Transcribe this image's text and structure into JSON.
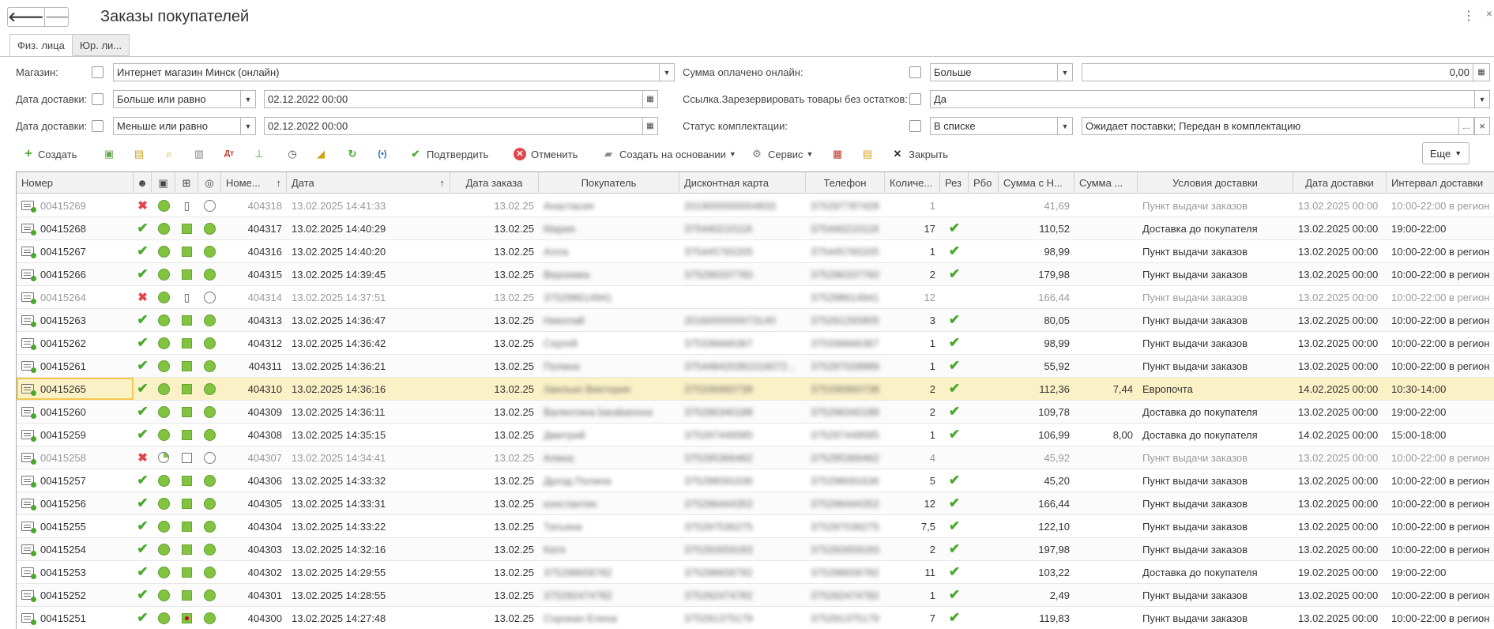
{
  "window": {
    "title": "Заказы покупателей",
    "nav_back": "🡐",
    "nav_forward": "🡒",
    "more": "⋮",
    "close": "×"
  },
  "tabs": [
    {
      "label": "Физ. лица",
      "active": true
    },
    {
      "label": "Юр. ли...",
      "active": false
    }
  ],
  "filters": {
    "magazin_label": "Магазин:",
    "magazin_value": "Интернет магазин Минск (онлайн)",
    "data_dost1_label": "Дата доставки:",
    "data_dost1_op": "Больше или равно",
    "data_dost1_value": "02.12.2022 00:00",
    "data_dost2_label": "Дата доставки:",
    "data_dost2_op": "Меньше или равно",
    "data_dost2_value": "02.12.2022 00:00",
    "summa_label": "Сумма оплачено онлайн:",
    "summa_op": "Больше",
    "summa_value": "0,00",
    "ssylka_label": "Ссылка.Зарезервировать товары без остатков:",
    "ssylka_value": "Да",
    "status_label": "Статус комплектации:",
    "status_op": "В списке",
    "status_value": "Ожидает поставки; Передан в комплектацию",
    "dots": "...",
    "clear": "×"
  },
  "toolbar": {
    "create": "Создать",
    "confirm": "Подтвердить",
    "cancel": "Отменить",
    "create_based": "Создать на основании",
    "service": "Сервис",
    "close": "Закрыть",
    "more": "Еще"
  },
  "colors": {
    "green": "#82c341",
    "check": "#4aa82c",
    "cross": "#e2454b",
    "selected_row": "#fbf1c7"
  },
  "columns": [
    "Номер",
    "Номе...",
    "Дата",
    "Дата заказа",
    "Покупатель",
    "Дисконтная карта",
    "Телефон",
    "Количе...",
    "Рез",
    "Рбо",
    "Сумма с Н...",
    "Сумма ...",
    "Условия доставки",
    "Дата доставки",
    "Интервал доставки"
  ],
  "sort_arrows": {
    "nome": "↑",
    "data": "↑"
  },
  "rows": [
    {
      "num": "00415269",
      "s1": "x",
      "s2": "dot",
      "s3": "book",
      "s4": "empty",
      "n2": "404318",
      "date": "13.02.2025 14:41:33",
      "dz": "13.02.25",
      "buyer": "Анастасия",
      "card": "2019000000004833",
      "phone": "375297787428",
      "qty": "1",
      "rez": "",
      "sum": "41,69",
      "sum2": "",
      "cond": "Пункт выдачи заказов",
      "dd": "13.02.2025 00:00",
      "int": "10:00-22:00 в регион",
      "grey": true
    },
    {
      "num": "00415268",
      "s1": "v",
      "s2": "dot",
      "s3": "sq",
      "s4": "dot",
      "n2": "404317",
      "date": "13.02.2025 14:40:29",
      "dz": "13.02.25",
      "buyer": "Мария",
      "card": "375440210118",
      "phone": "375440210118",
      "qty": "17",
      "rez": "v",
      "sum": "110,52",
      "sum2": "",
      "cond": "Доставка до покупателя",
      "dd": "13.02.2025 00:00",
      "int": "19:00-22:00"
    },
    {
      "num": "00415267",
      "s1": "v",
      "s2": "dot",
      "s3": "sq",
      "s4": "dot",
      "n2": "404316",
      "date": "13.02.2025 14:40:20",
      "dz": "13.02.25",
      "buyer": "Алла",
      "card": "375445765205",
      "phone": "375445765205",
      "qty": "1",
      "rez": "v",
      "sum": "98,99",
      "sum2": "",
      "cond": "Пункт выдачи заказов",
      "dd": "13.02.2025 00:00",
      "int": "10:00-22:00 в регион"
    },
    {
      "num": "00415266",
      "s1": "v",
      "s2": "dot",
      "s3": "sq",
      "s4": "dot",
      "n2": "404315",
      "date": "13.02.2025 14:39:45",
      "dz": "13.02.25",
      "buyer": "Вероника",
      "card": "375296337760",
      "phone": "375296337760",
      "qty": "2",
      "rez": "v",
      "sum": "179,98",
      "sum2": "",
      "cond": "Пункт выдачи заказов",
      "dd": "13.02.2025 00:00",
      "int": "10:00-22:00 в регион"
    },
    {
      "num": "00415264",
      "s1": "x",
      "s2": "dot",
      "s3": "book",
      "s4": "empty",
      "n2": "404314",
      "date": "13.02.2025 14:37:51",
      "dz": "13.02.25",
      "buyer": "375298614941",
      "card": "",
      "phone": "375298614941",
      "qty": "12",
      "rez": "",
      "sum": "166,44",
      "sum2": "",
      "cond": "Пункт выдачи заказов",
      "dd": "13.02.2025 00:00",
      "int": "10:00-22:00 в регион",
      "grey": true
    },
    {
      "num": "00415263",
      "s1": "v",
      "s2": "dot",
      "s3": "sq",
      "s4": "dot",
      "n2": "404313",
      "date": "13.02.2025 14:36:47",
      "dz": "13.02.25",
      "buyer": "Николай",
      "card": "2016000000073140",
      "phone": "375291265805",
      "qty": "3",
      "rez": "v",
      "sum": "80,05",
      "sum2": "",
      "cond": "Пункт выдачи заказов",
      "dd": "13.02.2025 00:00",
      "int": "10:00-22:00 в регион"
    },
    {
      "num": "00415262",
      "s1": "v",
      "s2": "dot",
      "s3": "sq",
      "s4": "dot",
      "n2": "404312",
      "date": "13.02.2025 14:36:42",
      "dz": "13.02.25",
      "buyer": "Сергей",
      "card": "375336666367",
      "phone": "375336666367",
      "qty": "1",
      "rez": "v",
      "sum": "98,99",
      "sum2": "",
      "cond": "Пункт выдачи заказов",
      "dd": "13.02.2025 00:00",
      "int": "10:00-22:00 в регион"
    },
    {
      "num": "00415261",
      "s1": "v",
      "s2": "dot",
      "s3": "sq",
      "s4": "dot",
      "n2": "404311",
      "date": "13.02.2025 14:36:21",
      "dz": "13.02.25",
      "buyer": "Полина",
      "card": "375448420391016072...",
      "phone": "375297028889",
      "qty": "1",
      "rez": "v",
      "sum": "55,92",
      "sum2": "",
      "cond": "Пункт выдачи заказов",
      "dd": "13.02.2025 00:00",
      "int": "10:00-22:00 в регион"
    },
    {
      "num": "00415265",
      "s1": "v",
      "s2": "dot",
      "s3": "sq",
      "s4": "dot",
      "n2": "404310",
      "date": "13.02.2025 14:36:16",
      "dz": "13.02.25",
      "buyer": "Хвелько Виктория",
      "card": "375336960738",
      "phone": "375336960738",
      "qty": "2",
      "rez": "v",
      "sum": "112,36",
      "sum2": "7,44",
      "cond": "Европочта",
      "dd": "14.02.2025 00:00",
      "int": "10:30-14:00",
      "sel": true
    },
    {
      "num": "00415260",
      "s1": "v",
      "s2": "dot",
      "s3": "sq",
      "s4": "dot",
      "n2": "404309",
      "date": "13.02.2025 14:36:11",
      "dz": "13.02.25",
      "buyer": "Валентина barabanova",
      "card": "375296340188",
      "phone": "375296340188",
      "qty": "2",
      "rez": "v",
      "sum": "109,78",
      "sum2": "",
      "cond": "Доставка до покупателя",
      "dd": "13.02.2025 00:00",
      "int": "19:00-22:00"
    },
    {
      "num": "00415259",
      "s1": "v",
      "s2": "dot",
      "s3": "sq",
      "s4": "dot",
      "n2": "404308",
      "date": "13.02.2025 14:35:15",
      "dz": "13.02.25",
      "buyer": "Дмитрий",
      "card": "375297449585",
      "phone": "375297449585",
      "qty": "1",
      "rez": "v",
      "sum": "106,99",
      "sum2": "8,00",
      "cond": "Доставка до покупателя",
      "dd": "14.02.2025 00:00",
      "int": "15:00-18:00"
    },
    {
      "num": "00415258",
      "s1": "x",
      "s2": "pie",
      "s3": "sqe",
      "s4": "empty",
      "n2": "404307",
      "date": "13.02.2025 14:34:41",
      "dz": "13.02.25",
      "buyer": "Алина",
      "card": "375295366462",
      "phone": "375295366462",
      "qty": "4",
      "rez": "",
      "sum": "45,92",
      "sum2": "",
      "cond": "Пункт выдачи заказов",
      "dd": "13.02.2025 00:00",
      "int": "10:00-22:00 в регион",
      "grey": true
    },
    {
      "num": "00415257",
      "s1": "v",
      "s2": "dot",
      "s3": "sq",
      "s4": "dot",
      "n2": "404306",
      "date": "13.02.2025 14:33:32",
      "dz": "13.02.25",
      "buyer": "Дрозд Полина",
      "card": "375298091636",
      "phone": "375298091636",
      "qty": "5",
      "rez": "v",
      "sum": "45,20",
      "sum2": "",
      "cond": "Пункт выдачи заказов",
      "dd": "13.02.2025 00:00",
      "int": "10:00-22:00 в регион"
    },
    {
      "num": "00415256",
      "s1": "v",
      "s2": "dot",
      "s3": "sq",
      "s4": "dot",
      "n2": "404305",
      "date": "13.02.2025 14:33:31",
      "dz": "13.02.25",
      "buyer": "константин",
      "card": "375296444352",
      "phone": "375296444352",
      "qty": "12",
      "rez": "v",
      "sum": "166,44",
      "sum2": "",
      "cond": "Пункт выдачи заказов",
      "dd": "13.02.2025 00:00",
      "int": "10:00-22:00 в регион"
    },
    {
      "num": "00415255",
      "s1": "v",
      "s2": "dot",
      "s3": "sq",
      "s4": "dot",
      "n2": "404304",
      "date": "13.02.2025 14:33:22",
      "dz": "13.02.25",
      "buyer": "Татьяна",
      "card": "375297536275",
      "phone": "375297536275",
      "qty": "7,5",
      "rez": "v",
      "sum": "122,10",
      "sum2": "",
      "cond": "Пункт выдачи заказов",
      "dd": "13.02.2025 00:00",
      "int": "10:00-22:00 в регион"
    },
    {
      "num": "00415254",
      "s1": "v",
      "s2": "dot",
      "s3": "sq",
      "s4": "dot",
      "n2": "404303",
      "date": "13.02.2025 14:32:16",
      "dz": "13.02.25",
      "buyer": "Катя",
      "card": "375292659183",
      "phone": "375292659183",
      "qty": "2",
      "rez": "v",
      "sum": "197,98",
      "sum2": "",
      "cond": "Пункт выдачи заказов",
      "dd": "13.02.2025 00:00",
      "int": "10:00-22:00 в регион"
    },
    {
      "num": "00415253",
      "s1": "v",
      "s2": "dot",
      "s3": "sq",
      "s4": "dot",
      "n2": "404302",
      "date": "13.02.2025 14:29:55",
      "dz": "13.02.25",
      "buyer": "375298658782",
      "card": "375298658782",
      "phone": "375298658782",
      "qty": "11",
      "rez": "v",
      "sum": "103,22",
      "sum2": "",
      "cond": "Доставка до покупателя",
      "dd": "19.02.2025 00:00",
      "int": "19:00-22:00"
    },
    {
      "num": "00415252",
      "s1": "v",
      "s2": "dot",
      "s3": "sq",
      "s4": "dot",
      "n2": "404301",
      "date": "13.02.2025 14:28:55",
      "dz": "13.02.25",
      "buyer": "375292474782",
      "card": "375292474782",
      "phone": "375292474782",
      "qty": "1",
      "rez": "v",
      "sum": "2,49",
      "sum2": "",
      "cond": "Пункт выдачи заказов",
      "dd": "13.02.2025 00:00",
      "int": "10:00-22:00 в регион"
    },
    {
      "num": "00415251",
      "s1": "v",
      "s2": "dot",
      "s3": "sqr",
      "s4": "dot",
      "n2": "404300",
      "date": "13.02.2025 14:27:48",
      "dz": "13.02.25",
      "buyer": "Сорокан Елена",
      "card": "375291375179",
      "phone": "375291375179",
      "qty": "7",
      "rez": "v",
      "sum": "119,83",
      "sum2": "",
      "cond": "Пункт выдачи заказов",
      "dd": "13.02.2025 00:00",
      "int": "10:00-22:00 в регион"
    }
  ]
}
